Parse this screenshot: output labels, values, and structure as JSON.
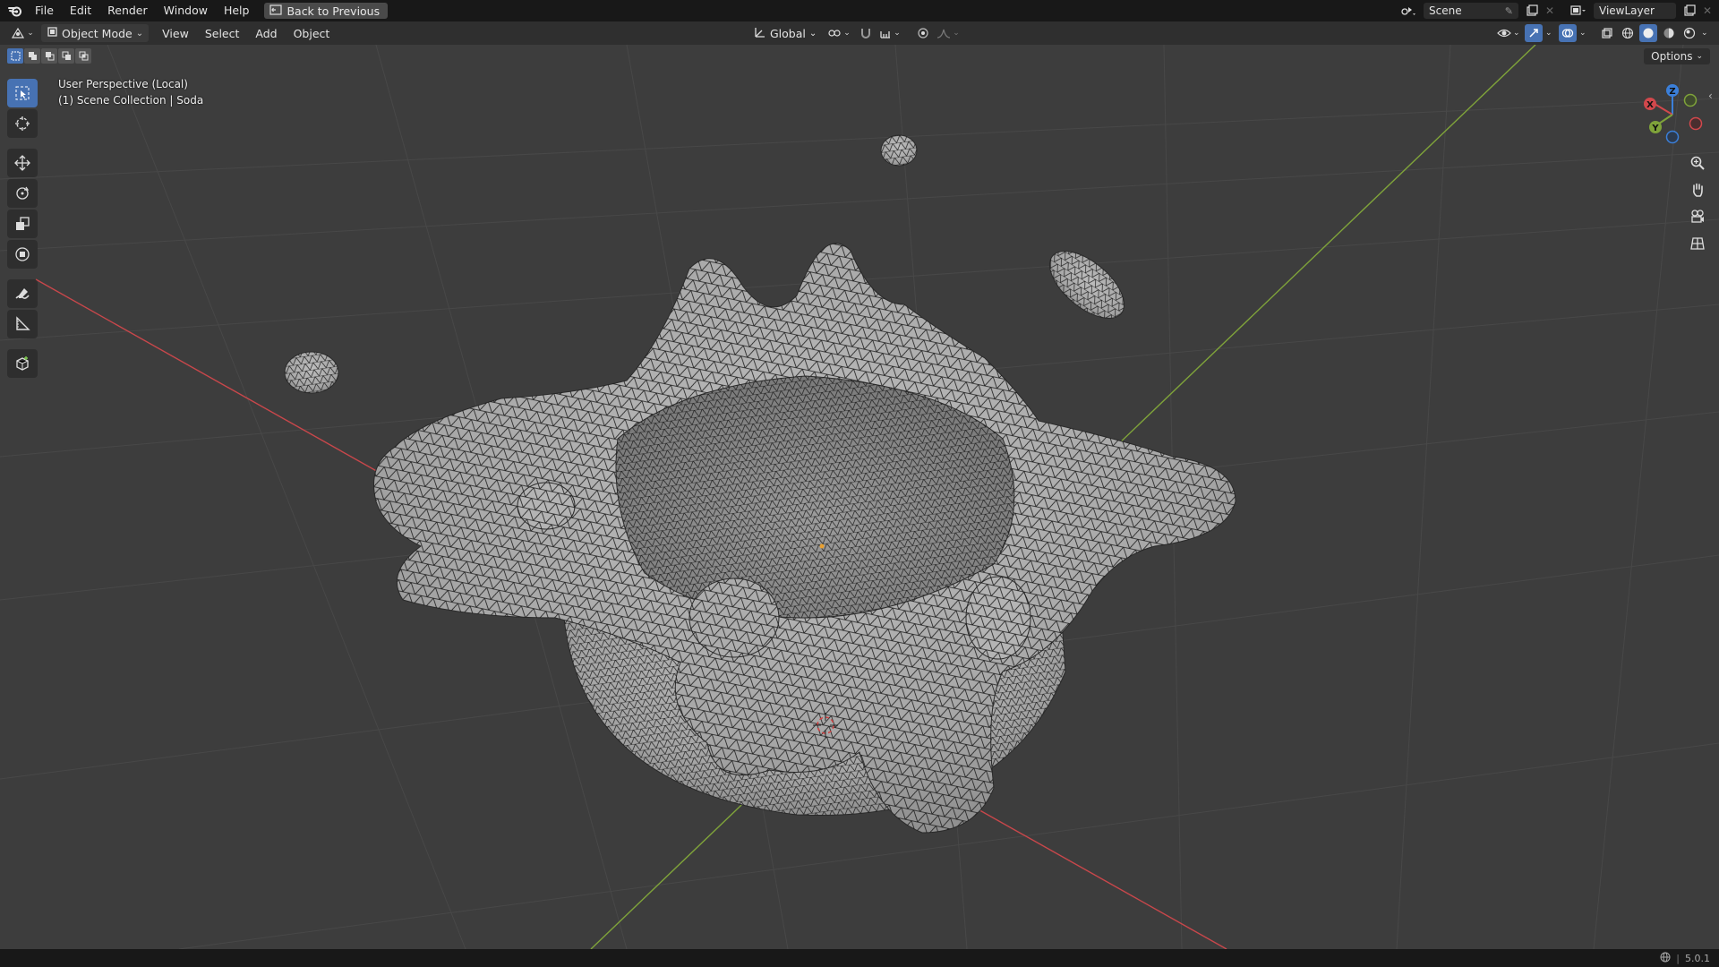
{
  "menubar": {
    "items": [
      "File",
      "Edit",
      "Render",
      "Window",
      "Help"
    ],
    "back_label": "Back to Previous",
    "scene_name": "Scene",
    "view_layer": "ViewLayer"
  },
  "header": {
    "mode": "Object Mode",
    "menus": [
      "View",
      "Select",
      "Add",
      "Object"
    ],
    "orientation": "Global"
  },
  "viewport": {
    "perspective": "User Perspective (Local)",
    "collection": "(1) Scene Collection | Soda",
    "options_label": "Options",
    "gizmo": {
      "x": "X",
      "y": "Y",
      "z": "Z"
    }
  },
  "status": {
    "version": "5.0.1"
  },
  "colors": {
    "accent": "#4772b3",
    "x_axis": "#d2484c",
    "y_axis": "#7fa33a",
    "z_axis": "#3b7fd9"
  },
  "icons": {
    "tools": [
      "select-box-icon",
      "cursor-icon",
      "move-icon",
      "rotate-icon",
      "scale-icon",
      "transform-icon",
      "annotate-icon",
      "measure-icon",
      "add-cube-icon"
    ]
  }
}
